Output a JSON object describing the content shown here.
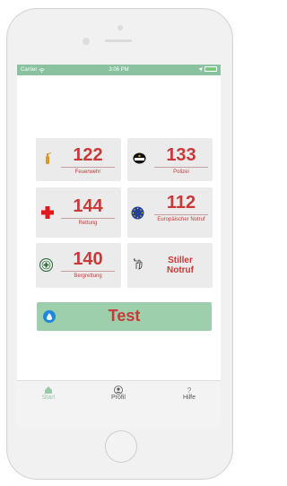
{
  "statusbar": {
    "carrier": "Carrier",
    "time": "3:06 PM"
  },
  "tiles": [
    {
      "number": "122",
      "label": "Feuerwehr",
      "icon": "fire-extinguisher-icon"
    },
    {
      "number": "133",
      "label": "Polizei",
      "icon": "police-cap-icon"
    },
    {
      "number": "144",
      "label": "Rettung",
      "icon": "red-cross-icon"
    },
    {
      "number": "112",
      "label": "Europäischer Notruf",
      "icon": "eu-flag-icon"
    },
    {
      "number": "140",
      "label": "Bergrettung",
      "icon": "mountain-rescue-badge-icon"
    },
    {
      "number": "",
      "label": "Stiller Notruf",
      "icon": "hand-gesture-icon"
    }
  ],
  "stiller": {
    "line1": "Stiller",
    "line2": "Notruf"
  },
  "test_button": {
    "label": "Test"
  },
  "tabbar": {
    "items": [
      {
        "label": "Start"
      },
      {
        "label": "Profil"
      },
      {
        "label": "Hilfe"
      }
    ]
  },
  "colors": {
    "accent": "#c83a3a",
    "green": "#9ecfac",
    "statusbar": "#8ac2a0"
  }
}
